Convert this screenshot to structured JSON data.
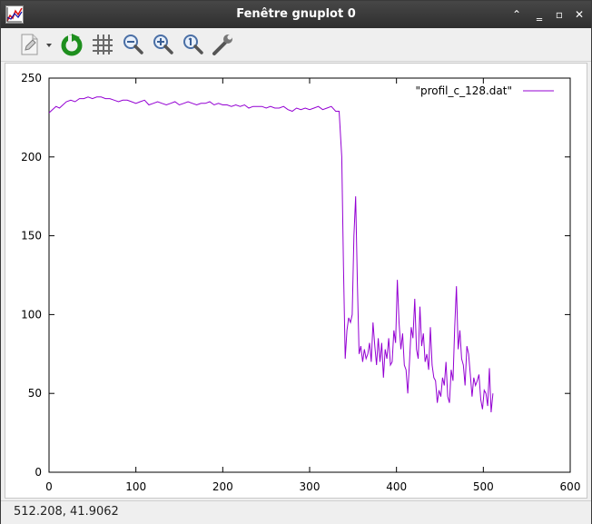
{
  "window": {
    "title": "Fenêtre gnuplot 0",
    "buttons": [
      {
        "name": "minimize-button",
        "icon": "chevron-up-icon",
        "glyph": "⌃"
      },
      {
        "name": "window-minimize-button",
        "icon": "minimize-icon",
        "glyph": "‗"
      },
      {
        "name": "maximize-button",
        "icon": "maximize-icon",
        "glyph": "▫"
      },
      {
        "name": "close-button",
        "icon": "close-icon",
        "glyph": "✕"
      }
    ]
  },
  "toolbar": {
    "items": [
      {
        "name": "export-menu-button",
        "icon": "export-document-icon"
      },
      {
        "name": "replot-button",
        "icon": "refresh-icon"
      },
      {
        "name": "grid-toggle-button",
        "icon": "grid-icon"
      },
      {
        "name": "zoom-previous-button",
        "icon": "zoom-out-icon"
      },
      {
        "name": "zoom-next-button",
        "icon": "zoom-in-icon"
      },
      {
        "name": "autoscale-button",
        "icon": "zoom-reset-icon"
      },
      {
        "name": "settings-button",
        "icon": "wrench-icon"
      }
    ]
  },
  "status": {
    "coords": "512.208,  41.9062"
  },
  "chart_data": {
    "type": "line",
    "title": "",
    "xlabel": "",
    "ylabel": "",
    "xlim": [
      0,
      600
    ],
    "ylim": [
      0,
      250
    ],
    "xticks": [
      "0",
      "100",
      "200",
      "300",
      "400",
      "500",
      "600"
    ],
    "yticks": [
      "0",
      "50",
      "100",
      "150",
      "200",
      "250"
    ],
    "grid": false,
    "legend_position": "top-right",
    "series": [
      {
        "name": "\"profil_c_128.dat\"",
        "color": "#9400d3",
        "x": [
          0,
          4,
          8,
          12,
          16,
          20,
          25,
          30,
          35,
          40,
          45,
          50,
          55,
          60,
          65,
          70,
          75,
          80,
          85,
          90,
          95,
          100,
          105,
          110,
          115,
          120,
          125,
          130,
          135,
          140,
          145,
          150,
          155,
          160,
          165,
          170,
          175,
          180,
          185,
          190,
          195,
          200,
          205,
          210,
          215,
          220,
          225,
          230,
          235,
          240,
          245,
          250,
          255,
          260,
          265,
          270,
          275,
          280,
          285,
          290,
          295,
          300,
          305,
          310,
          315,
          320,
          325,
          330,
          334,
          337,
          339,
          341,
          343,
          345,
          347,
          349,
          351,
          353,
          355,
          357,
          359,
          361,
          363,
          365,
          367,
          369,
          371,
          373,
          375,
          377,
          379,
          381,
          383,
          385,
          387,
          389,
          391,
          393,
          395,
          397,
          399,
          401,
          403,
          405,
          407,
          409,
          411,
          413,
          415,
          417,
          419,
          421,
          423,
          425,
          427,
          429,
          431,
          433,
          435,
          437,
          439,
          441,
          443,
          445,
          447,
          449,
          451,
          453,
          455,
          457,
          459,
          461,
          463,
          465,
          467,
          469,
          471,
          473,
          475,
          477,
          479,
          481,
          483,
          485,
          487,
          489,
          491,
          493,
          495,
          497,
          499,
          501,
          503,
          505,
          507,
          509,
          511
        ],
        "y": [
          228,
          230,
          232,
          231,
          233,
          235,
          236,
          235,
          237,
          237,
          238,
          237,
          238,
          238,
          237,
          237,
          236,
          235,
          236,
          236,
          235,
          234,
          235,
          236,
          233,
          234,
          235,
          234,
          233,
          234,
          235,
          233,
          234,
          235,
          234,
          233,
          234,
          234,
          235,
          233,
          234,
          233,
          233,
          232,
          233,
          232,
          233,
          231,
          232,
          232,
          232,
          231,
          232,
          231,
          231,
          232,
          230,
          229,
          231,
          230,
          231,
          230,
          231,
          232,
          230,
          231,
          232,
          229,
          229,
          200,
          130,
          72,
          90,
          98,
          95,
          100,
          150,
          175,
          120,
          75,
          80,
          70,
          78,
          72,
          75,
          82,
          70,
          95,
          80,
          68,
          85,
          70,
          82,
          60,
          78,
          72,
          85,
          68,
          70,
          90,
          82,
          122,
          95,
          78,
          88,
          68,
          65,
          50,
          70,
          92,
          85,
          110,
          78,
          72,
          105,
          80,
          88,
          70,
          75,
          65,
          92,
          68,
          60,
          58,
          44,
          52,
          48,
          60,
          55,
          70,
          48,
          44,
          65,
          58,
          92,
          118,
          78,
          90,
          72,
          68,
          55,
          80,
          75,
          62,
          48,
          60,
          55,
          58,
          62,
          46,
          40,
          52,
          50,
          42,
          66,
          38,
          50
        ]
      }
    ]
  }
}
